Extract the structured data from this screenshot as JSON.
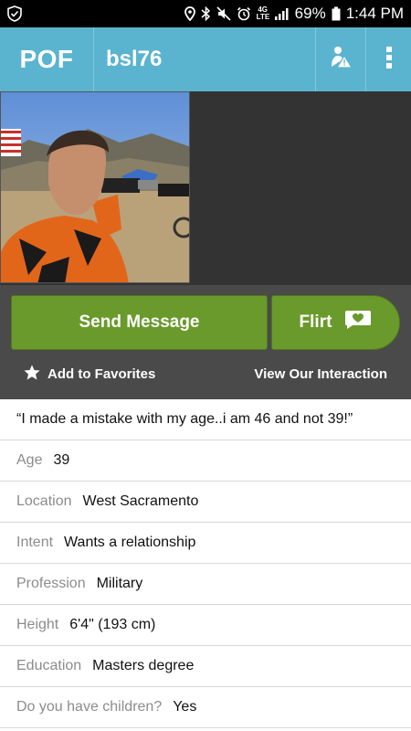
{
  "status_bar": {
    "battery": "69%",
    "time": "1:44 PM",
    "network": "4G LTE"
  },
  "header": {
    "logo": "POF",
    "username": "bsl76"
  },
  "actions": {
    "send_message": "Send Message",
    "flirt": "Flirt",
    "add_to_favorites": "Add to Favorites",
    "view_interaction": "View Our Interaction"
  },
  "profile": {
    "headline": "“I made a mistake with my age..i am 46 and not 39!”",
    "fields": [
      {
        "label": "Age",
        "value": "39"
      },
      {
        "label": "Location",
        "value": "West Sacramento"
      },
      {
        "label": "Intent",
        "value": "Wants a relationship"
      },
      {
        "label": "Profession",
        "value": "Military"
      },
      {
        "label": "Height",
        "value": "6'4\" (193 cm)"
      },
      {
        "label": "Education",
        "value": "Masters degree"
      },
      {
        "label": "Do you have children?",
        "value": "Yes"
      }
    ]
  },
  "colors": {
    "header": "#5ab4cf",
    "button_green": "#6a9a2b",
    "action_bg": "#4a4a4a"
  }
}
